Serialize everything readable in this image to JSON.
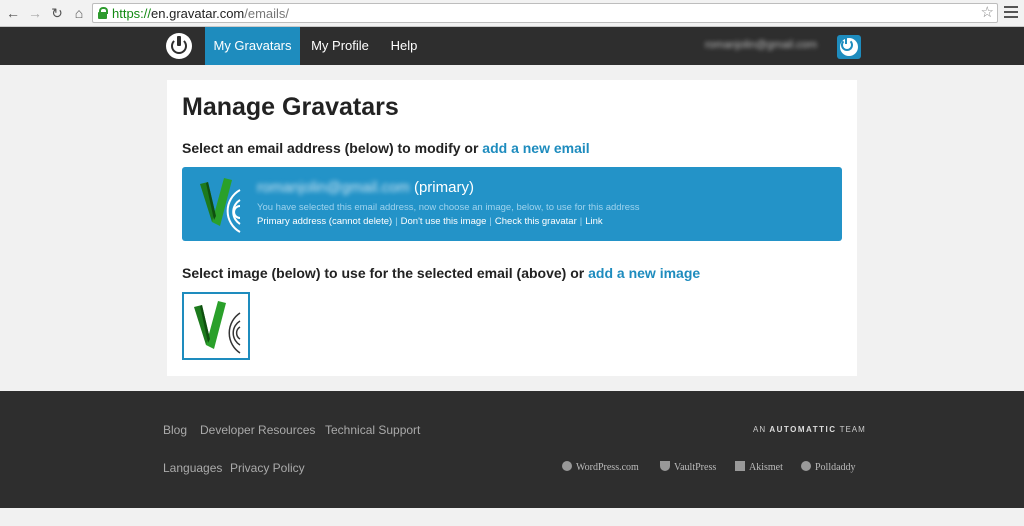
{
  "browser": {
    "url_scheme": "https://",
    "url_host": "en.gravatar.com",
    "url_path": "/emails/"
  },
  "header": {
    "nav": [
      {
        "label": "My Gravatars",
        "active": true
      },
      {
        "label": "My Profile",
        "active": false
      },
      {
        "label": "Help",
        "active": false
      }
    ],
    "user_email": "romanjolin@gmail.com"
  },
  "main": {
    "title": "Manage Gravatars",
    "select_email_text": "Select an email address (below) to modify or",
    "add_email_link": "add a new email",
    "email_entry": {
      "address": "romanjolin@gmail.com",
      "primary_label": "(primary)",
      "hint": "You have selected this email address, now choose an image, below, to use for this address",
      "links": [
        "Primary address (cannot delete)",
        "Don't use this image",
        "Check this gravatar",
        "Link"
      ]
    },
    "select_image_text": "Select image (below) to use for the selected email (above) or",
    "add_image_link": "add a new image"
  },
  "footer": {
    "links_row1": [
      "Blog",
      "Developer Resources",
      "Technical Support"
    ],
    "links_row2": [
      "Languages",
      "Privacy Policy"
    ],
    "automattic_prefix": "AN",
    "automattic_name": "AUTOMATTIC",
    "automattic_suffix": "TEAM",
    "brands": [
      "WordPress.com",
      "VaultPress",
      "Akismet",
      "Polldaddy"
    ]
  },
  "colors": {
    "accent": "#1e8cbe",
    "header_bg": "#2e2e2e",
    "email_box_bg": "#2393c8"
  }
}
